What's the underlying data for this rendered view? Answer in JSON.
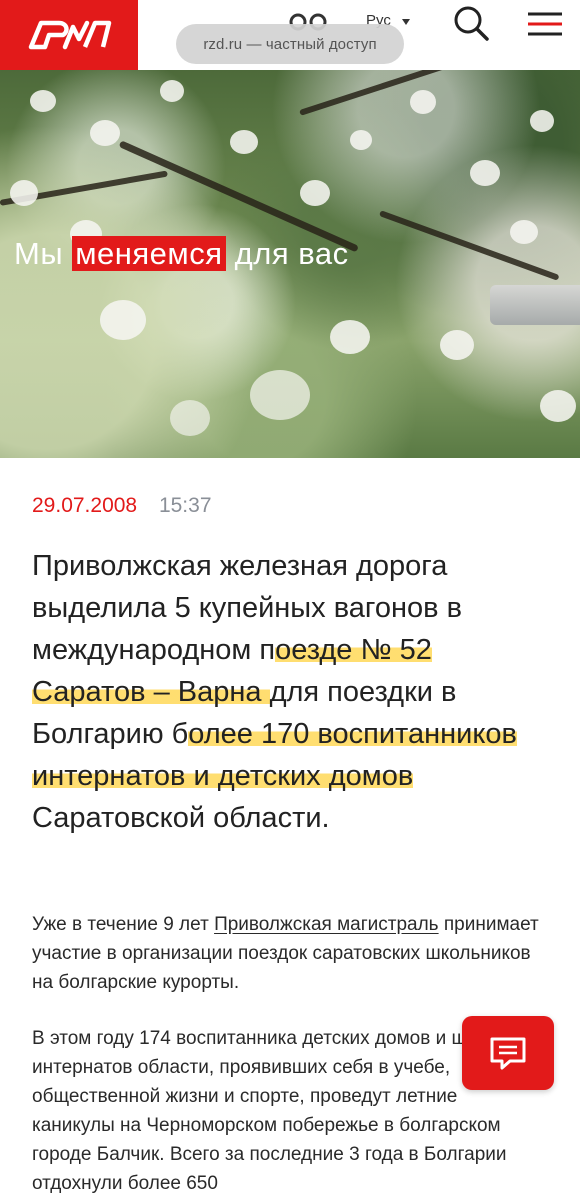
{
  "header": {
    "logo_text": "РЖД",
    "lang_label": "Рус",
    "url_pill": "rzd.ru — частный доступ"
  },
  "hero": {
    "title_before": "Мы ",
    "title_highlight": "меняемся",
    "title_after": " для вас"
  },
  "article": {
    "date": "29.07.2008",
    "time": "15:37",
    "lead": {
      "part1": "Приволжская железная дорога выделила 5 купейных вагонов в международном п",
      "mark1": "оезде № 52 Саратов – Варна ",
      "part2": "для поездки в Болгарию б",
      "mark2": "олее 170 воспитанников интернатов и детских домов",
      "part3": " Саратовской области."
    },
    "p1_before": "Уже в течение 9 лет ",
    "p1_link": "Приволжская магистраль",
    "p1_after": " принимает участие в организации поездок саратовских школьников на болгарские курорты.",
    "p2": "В этом году 174 воспитанника детских домов и школ-интернатов области, проявивших себя в учебе, общественной жизни и спорте, проведут летние каникулы на Черноморском побережье в болгарском городе Балчик. Всего за последние 3 года в Болгарии отдохнули более 650"
  },
  "colors": {
    "brand_red": "#e21a1a",
    "highlight_yellow": "#ffd64d",
    "time_gray": "#8a8f97"
  },
  "icons": [
    "eye-icon",
    "search-icon",
    "menu-icon",
    "chat-icon"
  ]
}
